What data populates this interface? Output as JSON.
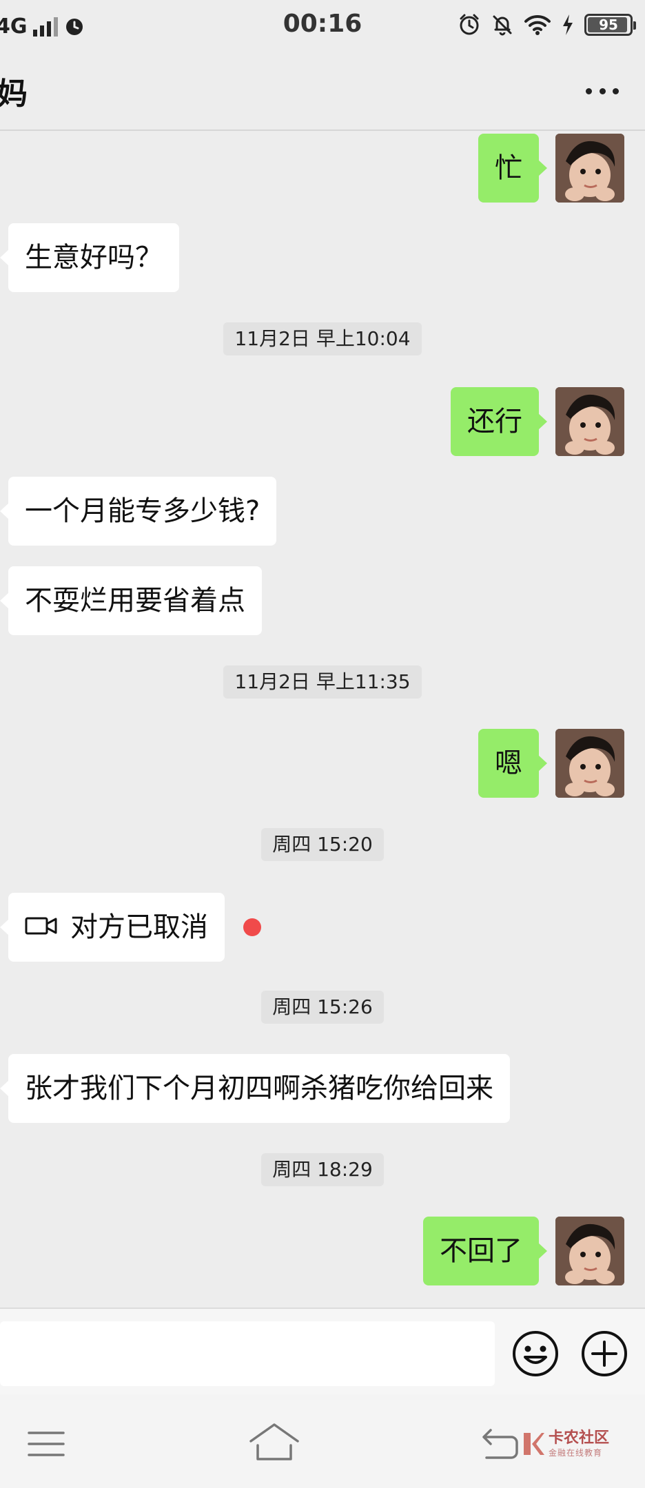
{
  "status_bar": {
    "network": "4G",
    "time": "00:16",
    "battery": "95",
    "battery_level": 0.95
  },
  "header": {
    "title": "妈"
  },
  "messages": {
    "m1": "忙",
    "m2": "生意好吗？",
    "t1": "11月2日 早上10:04",
    "m3": "还行",
    "m4": "一个月能专多少钱?",
    "m5": "不耍烂用要省着点",
    "t2": "11月2日 早上11:35",
    "m6": "嗯",
    "t3": "周四 15:20",
    "m7": "对方已取消",
    "t4": "周四 15:26",
    "m8": "张才我们下个月初四啊杀猪吃你给回来",
    "t5": "周四 18:29",
    "m9": "不回了"
  },
  "input_bar": {
    "value": "",
    "placeholder": ""
  },
  "watermark": {
    "main": "卡农社区",
    "sub": "金融在线教育"
  },
  "colors": {
    "background": "#ededed",
    "sent_bubble": "#95ec69",
    "received_bubble": "#ffffff",
    "unread_dot": "#f04a4a"
  },
  "icons": [
    "alarm-icon",
    "mute-icon",
    "wifi-icon",
    "charging-icon",
    "more-icon",
    "video-call-icon",
    "emoji-icon",
    "plus-icon",
    "menu-icon",
    "home-icon",
    "back-icon"
  ]
}
